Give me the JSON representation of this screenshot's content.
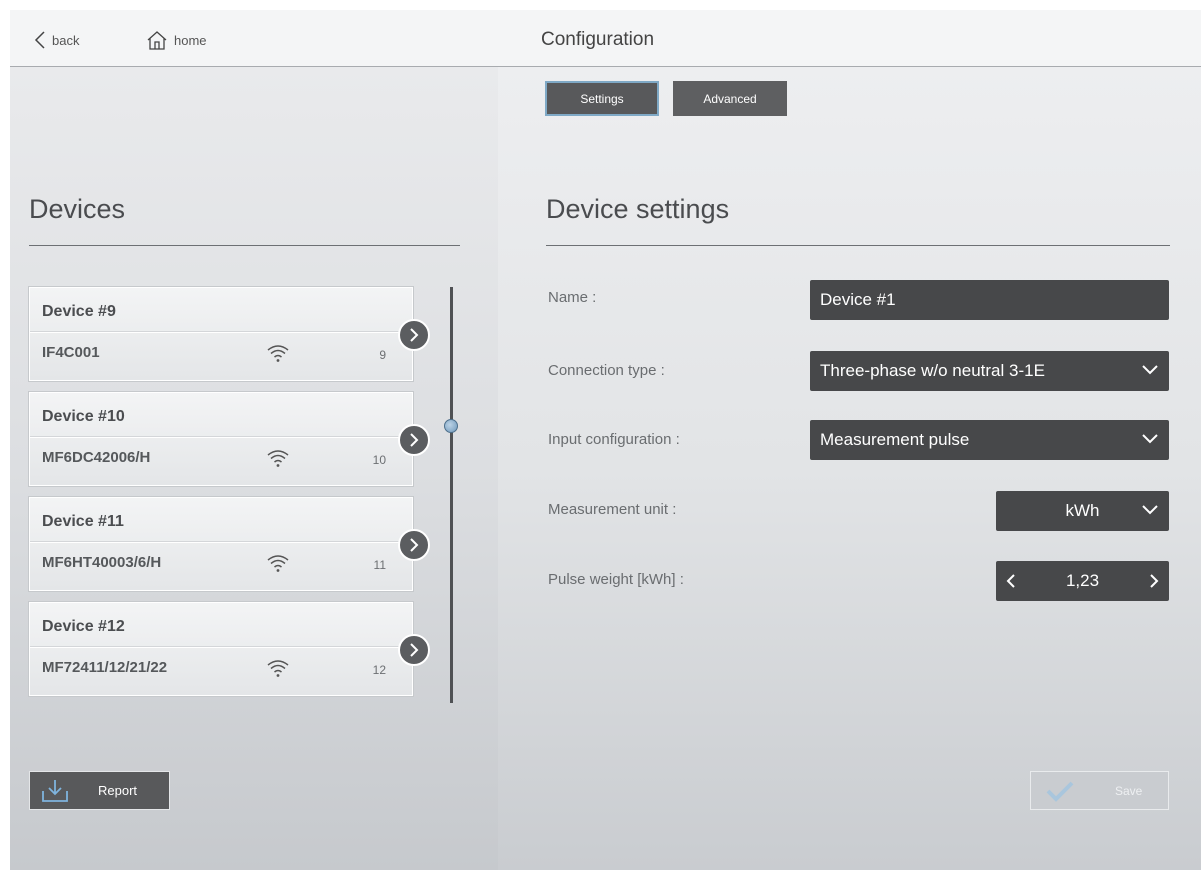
{
  "header": {
    "back_label": "back",
    "home_label": "home",
    "title": "Configuration"
  },
  "tabs": [
    {
      "label": "Settings",
      "active": true
    },
    {
      "label": "Advanced",
      "active": false
    }
  ],
  "devices_panel": {
    "title": "Devices",
    "items": [
      {
        "name": "Device #9",
        "serial": "IF4C001",
        "number": "9"
      },
      {
        "name": "Device #10",
        "serial": "MF6DC42006/H",
        "number": "10"
      },
      {
        "name": "Device #11",
        "serial": "MF6HT40003/6/H",
        "number": "11"
      },
      {
        "name": "Device #12",
        "serial": "MF72411/12/21/22",
        "number": "12"
      }
    ],
    "report_label": "Report"
  },
  "settings_panel": {
    "title": "Device settings",
    "name_label": "Name :",
    "name_value": "Device #1",
    "connection_label": "Connection type :",
    "connection_value": "Three-phase w/o neutral 3-1E",
    "input_label": "Input configuration :",
    "input_value": "Measurement pulse",
    "unit_label": "Measurement unit :",
    "unit_value": "kWh",
    "pulse_label": "Pulse weight [kWh] :",
    "pulse_value": "1,23",
    "save_label": "Save"
  },
  "colors": {
    "accent": "#7fa9c6",
    "dark_field": "#47484a",
    "button": "#58595b"
  }
}
